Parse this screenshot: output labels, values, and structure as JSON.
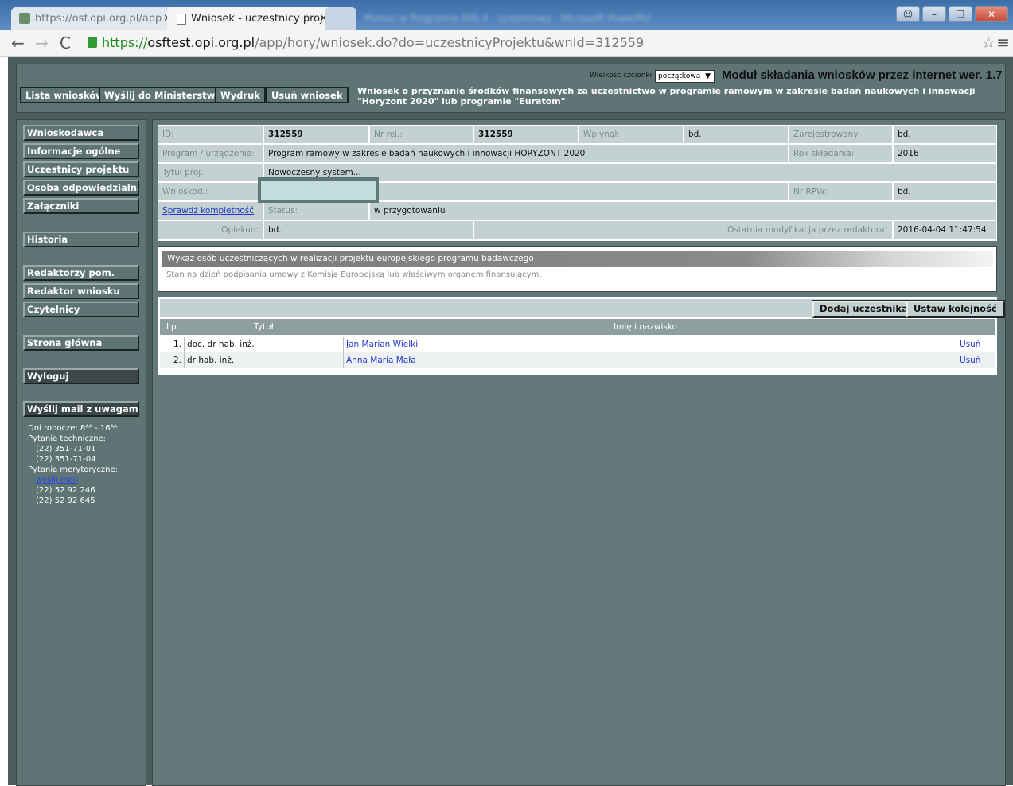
{
  "browser": {
    "tab1_title": "https://osf.opi.org.pl/app",
    "tab2_title": "Wniosek - uczestnicy proj",
    "tab_blurred": "Pomoc w Programie FAS 4 - systemowy - Microsoft PowerPoint",
    "url_scheme": "https://",
    "url_host": "osftest.opi.org.pl",
    "url_path": "/app/hory/wniosek.do?do=uczestnicyProjektu&wnId=312559"
  },
  "header": {
    "font_size_label": "Wielkość czcionki",
    "font_size_value": "początkowa",
    "module_title": "Moduł składania wniosków przez internet wer. 1.7",
    "subtitle": "Wniosek o przyznanie środków finansowych za uczestnictwo w programie ramowym w zakresie badań naukowych i innowacji \"Horyzont 2020\" lub programie \"Euratom\"",
    "buttons": [
      "Lista wniosków",
      "Wyślij do Ministerstwa",
      "Wydruk",
      "Usuń wniosek"
    ]
  },
  "sidebar": {
    "items": [
      "Wnioskodawca",
      "Informacje ogólne",
      "Uczestnicy projektu",
      "Osoba odpowiedzialna",
      "Załączniki",
      "Historia",
      "Redaktorzy pom.",
      "Redaktor wniosku",
      "Czytelnicy",
      "Strona główna",
      "Wyloguj",
      "Wyślij mail z uwagami"
    ],
    "contact": {
      "hours": "Dni robocze: 8ᴬᴬ - 16ᴬᴬ",
      "tech_label": "Pytania techniczne:",
      "tech_phone1": "(22) 351-71-01",
      "tech_phone2": "(22) 351-71-04",
      "merit_label": "Pytania merytoryczne:",
      "mail_link": "wyślij mail",
      "merit_phone1": "(22) 52 92 246",
      "merit_phone2": "(22) 52 92 645"
    }
  },
  "info": {
    "id_label": "ID:",
    "id_value": "312559",
    "nrrej_label": "Nr rej.:",
    "nrrej_value": "312559",
    "wplynal_label": "Wpłynął:",
    "wplynal_value": "bd.",
    "zarejestrowany_label": "Zarejestrowany:",
    "zarejestrowany_value": "bd.",
    "program_label": "Program / urządzenie:",
    "program_value": "Program ramowy w zakresie badań naukowych i innowacji HORYZONT 2020",
    "rok_label": "Rok składania:",
    "rok_value": "2016",
    "tytul_label": "Tytuł proj.:",
    "tytul_value": "Nowoczesny system...",
    "wnioskod_label": "Wnioskod.:",
    "nrrpw_label": "Nr RPW:",
    "nrrpw_value": "bd.",
    "check_link": "Sprawdź kompletność",
    "status_label": "Status:",
    "status_value": "w przygotowaniu",
    "opiekun_label": "Opiekun:",
    "opiekun_value": "bd.",
    "modified_label": "Ostatnia modyfikacja przez redaktora:",
    "modified_value": "2016-04-04 11:47:54"
  },
  "list_header": {
    "title": "Wykaz osób uczestniczących w realizacji projektu europejskiego programu badawczego",
    "note": "Stan na dzień podpisania umowy z Komisją Europejską lub właściwym organem finansującym."
  },
  "participants": {
    "add_button": "Dodaj uczestnika",
    "order_button": "Ustaw kolejność",
    "columns": [
      "Lp.",
      "Tytuł",
      "Imię i nazwisko"
    ],
    "rows": [
      {
        "lp": "1.",
        "title": "doc. dr hab. inż.",
        "name": "Jan Marian Wielki",
        "action": "Usuń"
      },
      {
        "lp": "2.",
        "title": "dr hab. inż.",
        "name": "Anna Maria Mała",
        "action": "Usuń"
      }
    ]
  }
}
